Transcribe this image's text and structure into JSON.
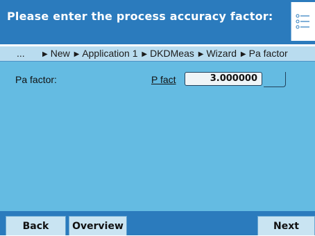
{
  "header": {
    "title": "Please enter the process accuracy factor:",
    "menu_icon": "list-menu-icon"
  },
  "breadcrumb": {
    "ellipsis": "...",
    "items": [
      "New",
      "Application 1",
      "DKDMeas",
      "Wizard",
      "Pa factor"
    ]
  },
  "form": {
    "label": "Pa factor:",
    "short_label": "P fact",
    "value": "3.000000",
    "unit": ""
  },
  "softkeys": {
    "back": "Back",
    "overview": "Overview",
    "next": "Next"
  },
  "colors": {
    "header_bg": "#2b7bbd",
    "content_bg": "#64bbe2",
    "breadcrumb_bg": "#b9dcef",
    "softkey_bg": "#c9e4f2"
  }
}
